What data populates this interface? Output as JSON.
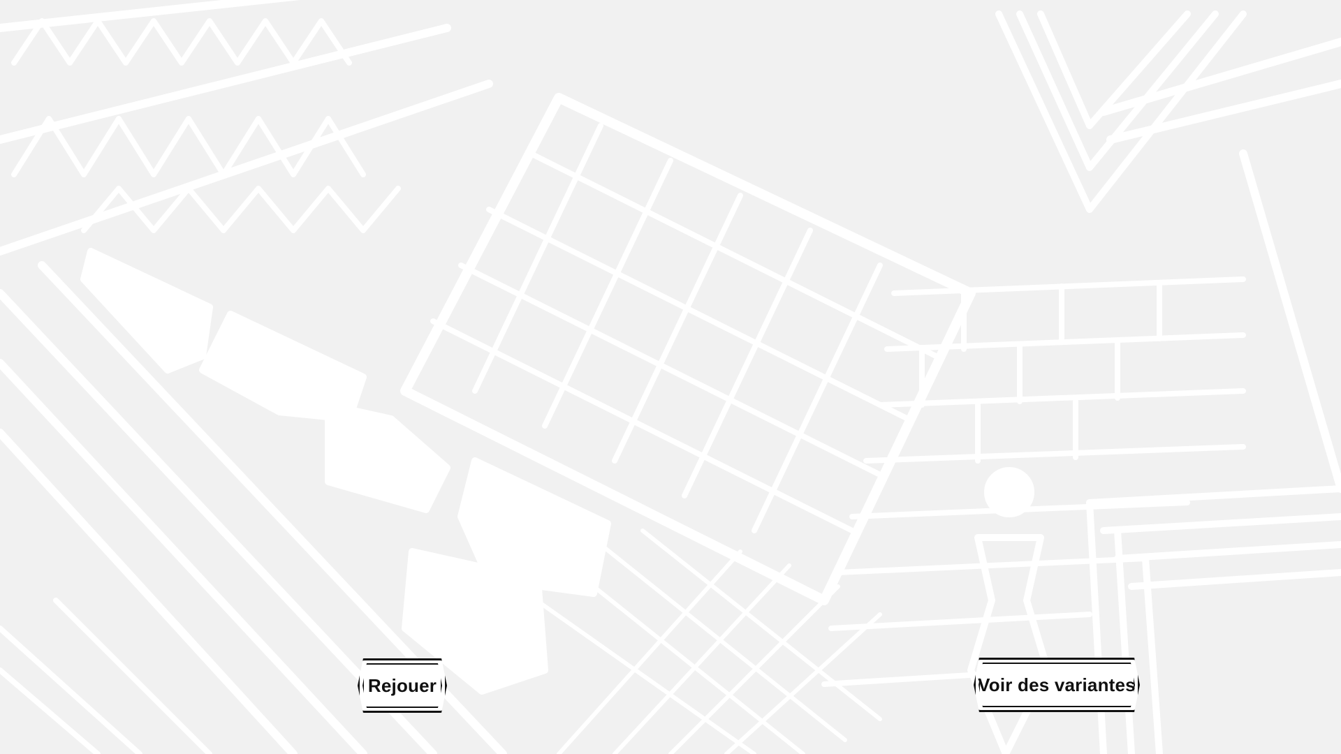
{
  "screen": {
    "background_color": "#f1f1f1",
    "pattern_color": "#ffffff",
    "accent_color": "#111111"
  },
  "actions": {
    "replay_label": "Rejouer",
    "variants_label": "Voir des variantes"
  }
}
